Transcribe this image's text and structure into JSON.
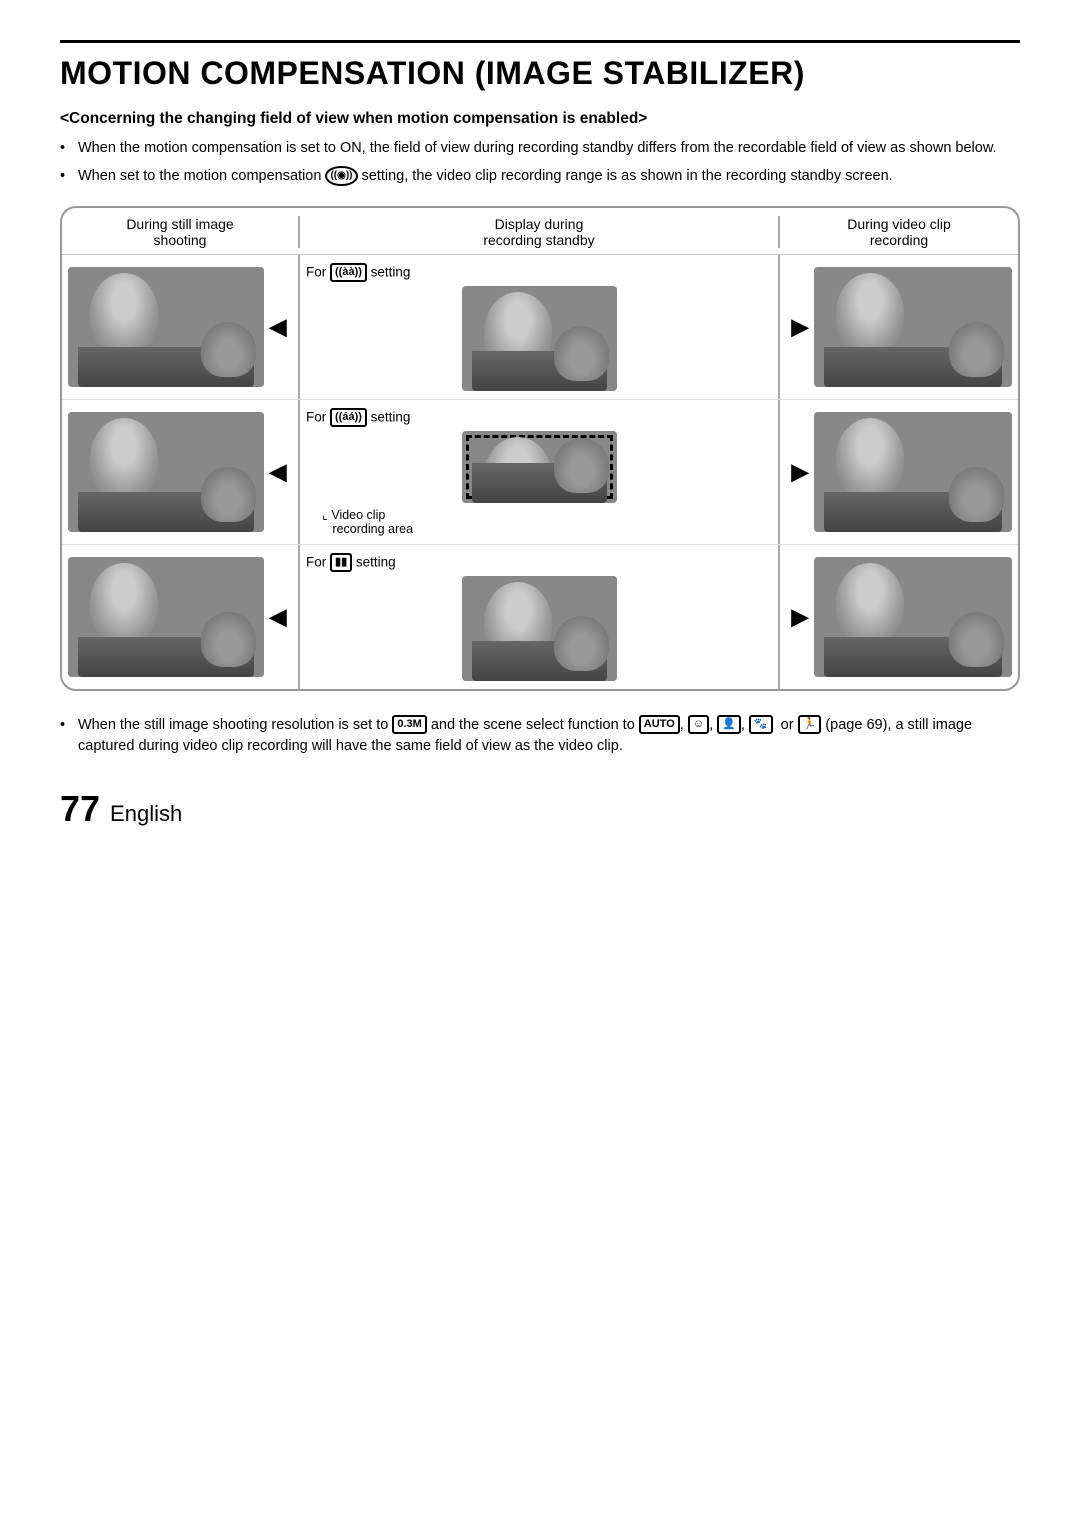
{
  "page": {
    "title": "MOTION COMPENSATION (IMAGE STABILIZER)",
    "subtitle": "<Concerning the changing field of view when motion compensation is enabled>",
    "bullets": [
      "When the motion compensation is set to ON, the field of view during recording standby differs from the recordable field of view as shown below.",
      "When set to the motion compensation [icon_round] setting, the video clip recording range is as shown in the recording standby screen."
    ],
    "diagram": {
      "col_headers": {
        "left": "During still image shooting",
        "mid": "Display during recording standby",
        "right": "During video clip recording"
      },
      "rows": [
        {
          "for_label": "For [icon1] setting",
          "mid_dashed": false
        },
        {
          "for_label": "For [icon2] setting",
          "mid_dashed": true,
          "video_clip_label": "Video clip recording area"
        },
        {
          "for_label": "For [icon3] setting",
          "mid_dashed": false
        }
      ]
    },
    "bottom_bullets": [
      "When the still image shooting resolution is set to [0.3M] and the scene select function to [AUTO], [icon_face], [icon_kids], [icon_pet] or [icon_sport] (page 69), a still image captured during video clip recording will have the same field of view as the video clip."
    ],
    "footer": {
      "page_number": "77",
      "language": "English"
    }
  }
}
